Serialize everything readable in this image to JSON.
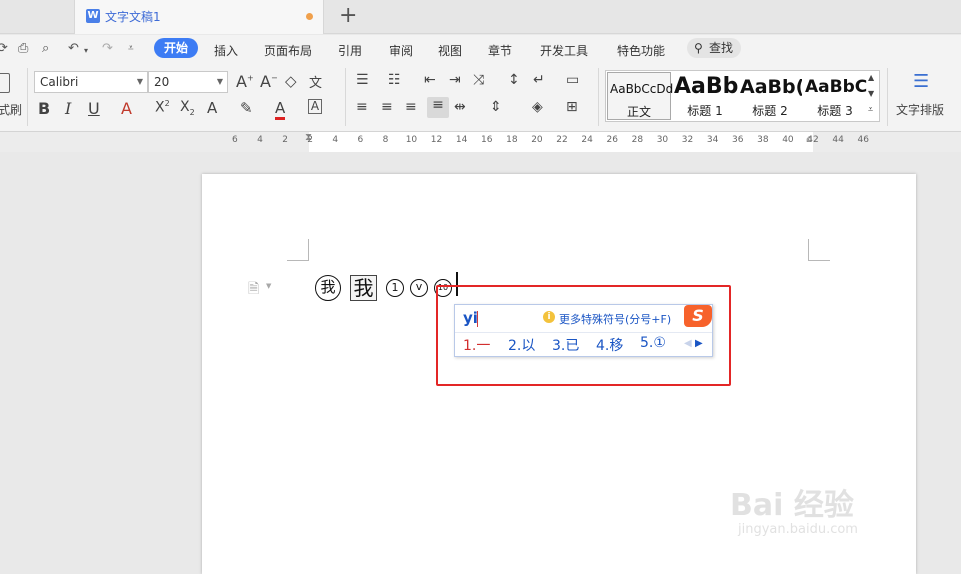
{
  "tab": {
    "icon_letter": "W",
    "title": "文字文稿1",
    "add_label": "+"
  },
  "menu": {
    "items": [
      "开始",
      "插入",
      "页面布局",
      "引用",
      "审阅",
      "视图",
      "章节",
      "开发工具",
      "特色功能"
    ],
    "search_label": "查找"
  },
  "ribbon": {
    "format_painter_label": "式刷",
    "font_name": "Calibri",
    "font_size": "20",
    "styles": [
      {
        "preview": "AaBbCcDd",
        "label": "正文"
      },
      {
        "preview": "AaBb",
        "label": "标题 1"
      },
      {
        "preview": "AaBb(",
        "label": "标题 2"
      },
      {
        "preview": "AaBbC",
        "label": "标题 3"
      }
    ],
    "text_layout_label": "文字排版"
  },
  "ruler": {
    "ticks": [
      "6",
      "4",
      "2",
      "2",
      "4",
      "6",
      "8",
      "10",
      "12",
      "14",
      "16",
      "18",
      "20",
      "22",
      "24",
      "26",
      "28",
      "30",
      "32",
      "34",
      "36",
      "38",
      "40",
      "42",
      "44",
      "46"
    ]
  },
  "document": {
    "circled_char": "我",
    "boxed_char": "我",
    "small_marks": [
      "1",
      "v",
      "10"
    ]
  },
  "ime": {
    "pinyin": "yi",
    "hint_icon": "i",
    "hint": "更多特殊符号(分号+F)",
    "logo": "S",
    "candidates": [
      "1.一",
      "2.以",
      "3.已",
      "4.移",
      "5.①"
    ]
  },
  "watermark": {
    "brand": "Bai 经验",
    "url": "jingyan.baidu.com"
  },
  "colors": {
    "accent": "#3d7cf4",
    "highlight": "#e32626",
    "ime_text": "#1a55c4"
  }
}
